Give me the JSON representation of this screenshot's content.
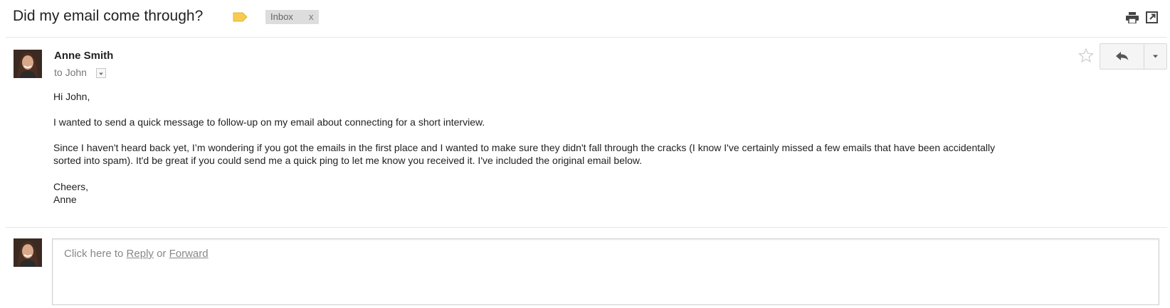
{
  "thread": {
    "subject": "Did my email come through?",
    "label_chip": "Inbox",
    "label_chip_remove": "x",
    "label_color": "#f7cb4d"
  },
  "message": {
    "sender_name": "Anne Smith",
    "recipient_line": "to John",
    "body": {
      "greeting": "Hi John,",
      "paragraph_1": "I wanted to send a quick message to follow-up on my email about connecting for a short interview.",
      "paragraph_2_line_1": "Since I haven't heard back yet, I’m wondering if you got the emails in the first place and I wanted to make sure they didn't fall through the cracks (I know I've certainly missed a few emails that have been accidentally",
      "paragraph_2_line_2": "sorted into spam). It'd be great if you could send me a quick ping to let me know you received it. I've included the original email below.",
      "closing": "Cheers,",
      "signature": "Anne"
    }
  },
  "reply_box": {
    "prefix": "Click here to ",
    "reply_link": "Reply",
    "separator": " or ",
    "forward_link": "Forward"
  },
  "icons": {
    "label": "label-tag-icon",
    "print": "print-icon",
    "popout": "popout-icon",
    "star": "star-icon",
    "reply": "reply-arrow-icon",
    "more": "chevron-down-icon",
    "recipient_details": "chevron-down-icon"
  }
}
